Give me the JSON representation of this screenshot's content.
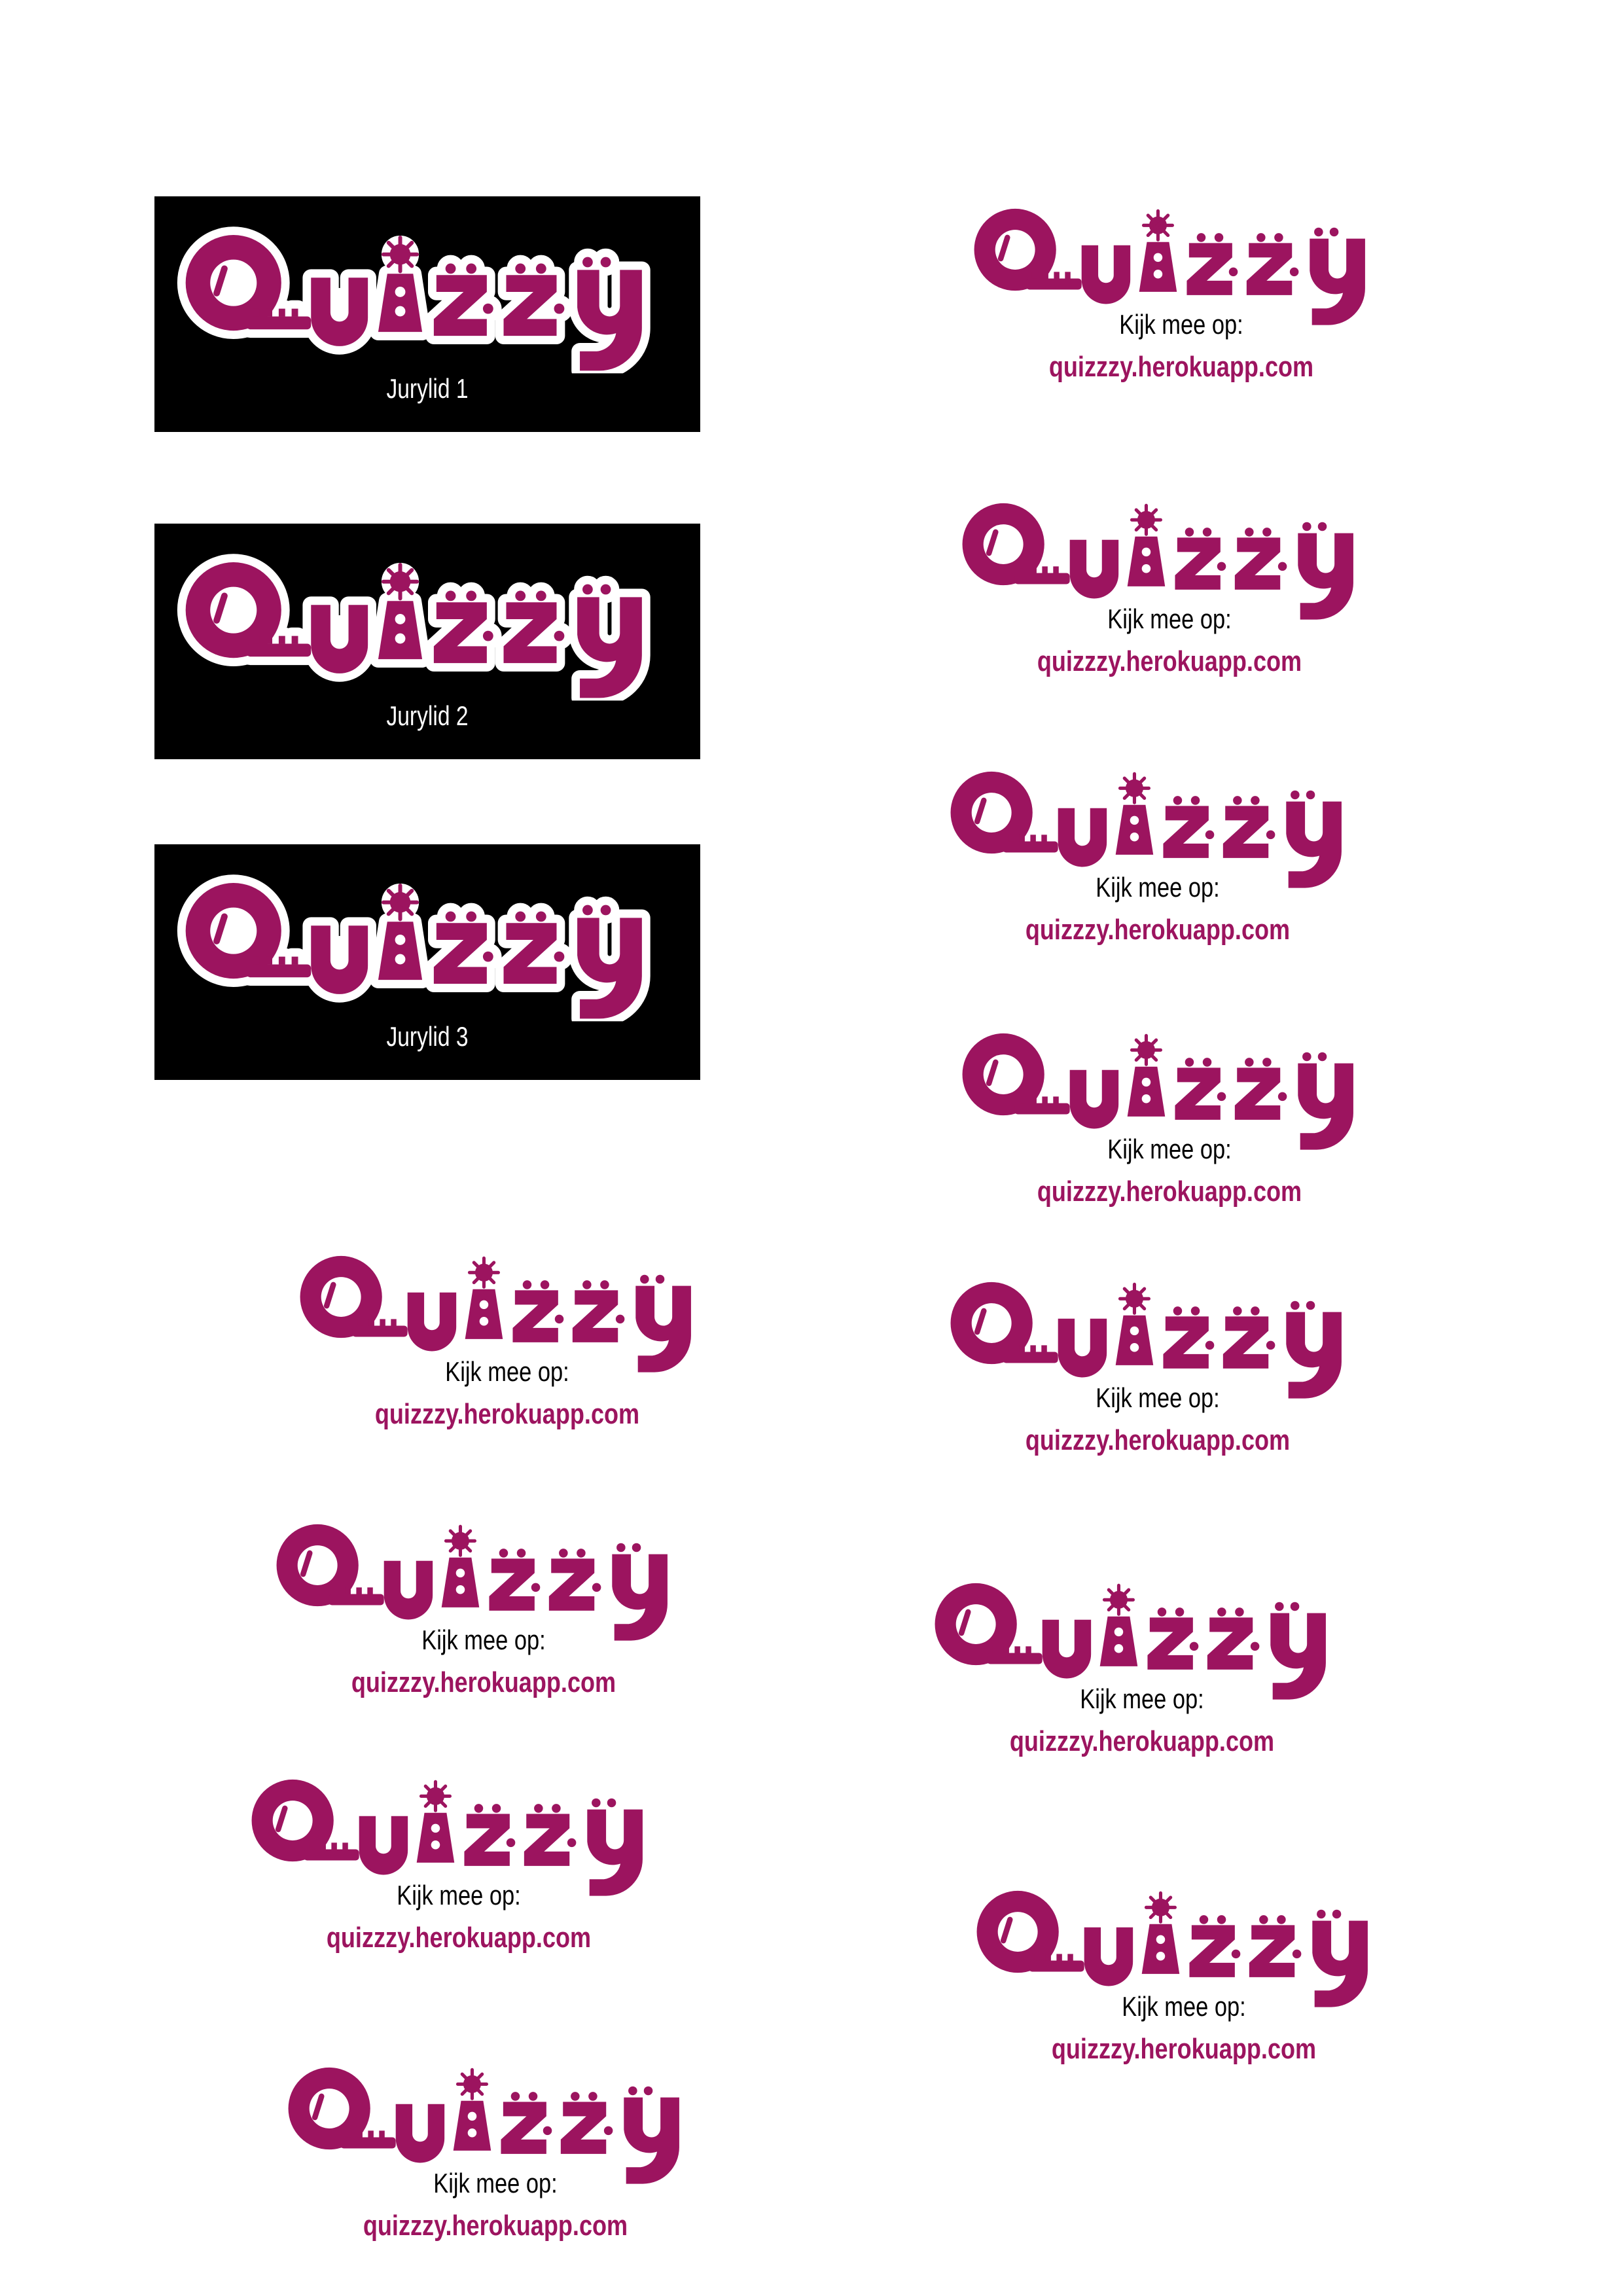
{
  "brand": {
    "name": "Quizzy",
    "logo_color": "#9c145f",
    "logo_outline_color": "#ffffff",
    "card_background": "#000000"
  },
  "jury_cards": [
    {
      "label": "Jurylid 1"
    },
    {
      "label": "Jurylid 2"
    },
    {
      "label": "Jurylid 3"
    }
  ],
  "promo": {
    "line1": "Kijk mee op:",
    "url": "quizzzy.herokuapp.com"
  },
  "promo_count": 11
}
